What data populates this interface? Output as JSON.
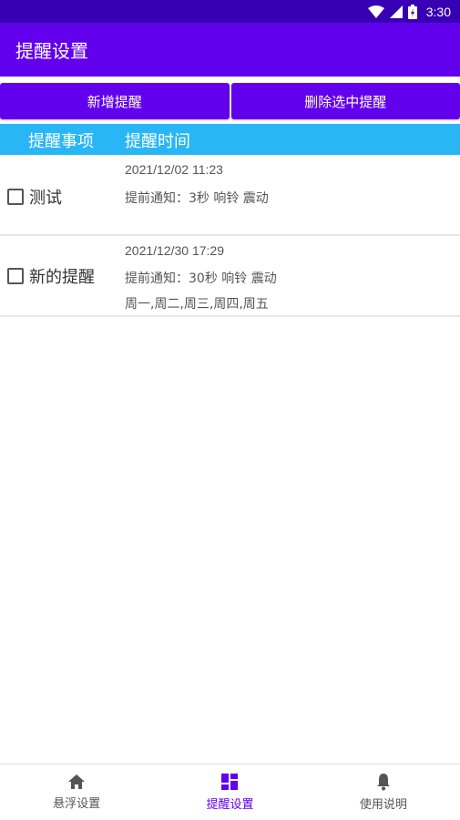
{
  "status_bar": {
    "time": "3:30"
  },
  "app_bar": {
    "title": "提醒设置"
  },
  "actions": {
    "add_label": "新增提醒",
    "delete_label": "删除选中提醒"
  },
  "table_header": {
    "col_item": "提醒事项",
    "col_time": "提醒时间"
  },
  "reminders": [
    {
      "name": "测试",
      "checked": false,
      "datetime": "2021/12/02  11:23",
      "notice": "提前通知：3秒  响铃  震动",
      "days": ""
    },
    {
      "name": "新的提醒",
      "checked": false,
      "datetime": "2021/12/30  17:29",
      "notice": "提前通知：30秒  响铃  震动",
      "days": "周一,周二,周三,周四,周五"
    }
  ],
  "bottom_nav": {
    "items": [
      {
        "label": "悬浮设置",
        "icon": "home-icon"
      },
      {
        "label": "提醒设置",
        "icon": "dashboard-icon",
        "active": true
      },
      {
        "label": "使用说明",
        "icon": "bell-icon"
      }
    ]
  },
  "colors": {
    "status_bar": "#3700B3",
    "primary": "#6200EE",
    "header": "#29B6F6"
  }
}
